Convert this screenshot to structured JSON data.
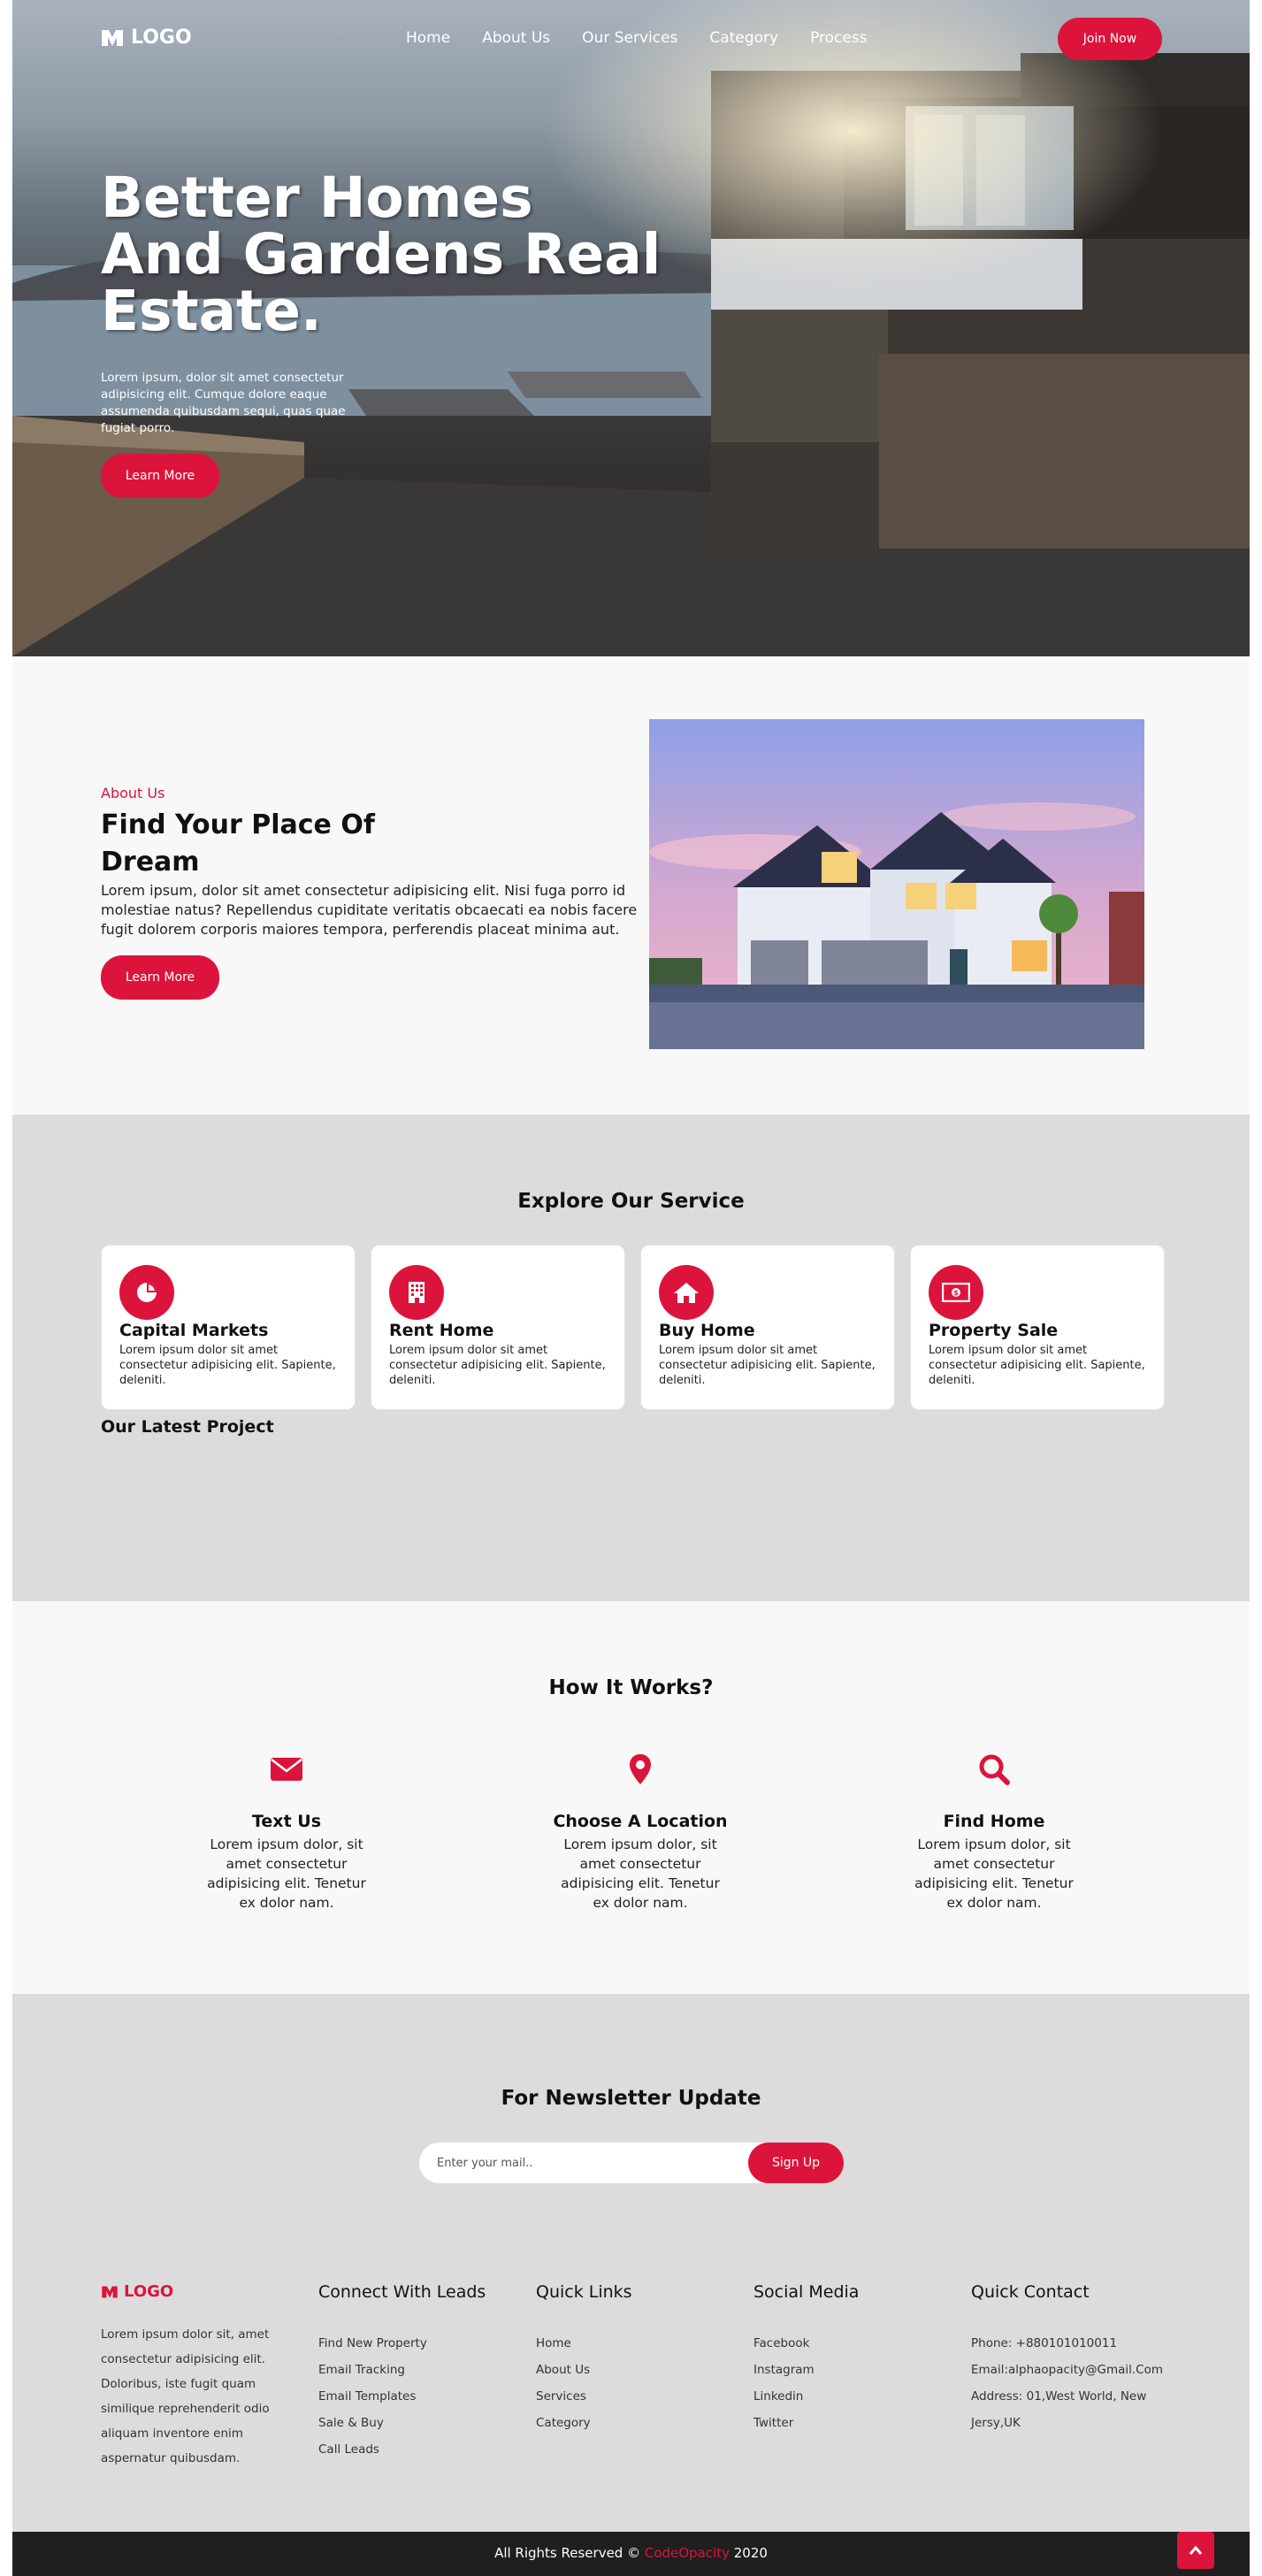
{
  "header": {
    "logo_text": "LOGO",
    "nav": [
      "Home",
      "About Us",
      "Our Services",
      "Category",
      "Process"
    ],
    "join_label": "Join Now"
  },
  "hero": {
    "title": "Better Homes And Gardens Real Estate.",
    "text": "Lorem ipsum, dolor sit amet consectetur adipisicing elit. Cumque dolore eaque assumenda quibusdam sequi, quas quae fugiat porro.",
    "button_label": "Learn More"
  },
  "about": {
    "eyebrow": "About Us",
    "title": "Find Your Place Of Dream",
    "text": "Lorem ipsum, dolor sit amet consectetur adipisicing elit. Nisi fuga porro id molestiae natus? Repellendus cupiditate veritatis obcaecati ea nobis facere fugit dolorem corporis maiores tempora, perferendis placeat minima aut.",
    "button_label": "Learn More"
  },
  "services": {
    "title": "Explore Our Service",
    "cards": [
      {
        "icon": "pie-chart-icon",
        "title": "Capital Markets",
        "text": "Lorem ipsum dolor sit amet consectetur adipisicing elit. Sapiente, deleniti."
      },
      {
        "icon": "building-icon",
        "title": "Rent Home",
        "text": "Lorem ipsum dolor sit amet consectetur adipisicing elit. Sapiente, deleniti."
      },
      {
        "icon": "home-icon",
        "title": "Buy Home",
        "text": "Lorem ipsum dolor sit amet consectetur adipisicing elit. Sapiente, deleniti."
      },
      {
        "icon": "money-bill-icon",
        "title": "Property Sale",
        "text": "Lorem ipsum dolor sit amet consectetur adipisicing elit. Sapiente, deleniti."
      }
    ],
    "latest_title": "Our Latest Project"
  },
  "how": {
    "title": "How It Works?",
    "steps": [
      {
        "icon": "envelope-icon",
        "title": "Text Us",
        "text": "Lorem ipsum dolor, sit amet consectetur adipisicing elit. Tenetur ex dolor nam."
      },
      {
        "icon": "map-marker-icon",
        "title": "Choose A Location",
        "text": "Lorem ipsum dolor, sit amet consectetur adipisicing elit. Tenetur ex dolor nam."
      },
      {
        "icon": "search-icon",
        "title": "Find Home",
        "text": "Lorem ipsum dolor, sit amet consectetur adipisicing elit. Tenetur ex dolor nam."
      }
    ]
  },
  "newsletter": {
    "title": "For Newsletter Update",
    "placeholder": "Enter your mail..",
    "button_label": "Sign Up"
  },
  "footer": {
    "logo_text": "LOGO",
    "about_text": "Lorem ipsum dolor sit, amet consectetur adipisicing elit. Doloribus, iste fugit quam similique reprehenderit odio aliquam inventore enim aspernatur quibusdam.",
    "columns": [
      {
        "title": "Connect With Leads",
        "items": [
          "Find New Property",
          "Email Tracking",
          "Email Templates",
          "Sale & Buy",
          "Call Leads"
        ]
      },
      {
        "title": "Quick Links",
        "items": [
          "Home",
          "About Us",
          "Services",
          "Category"
        ]
      },
      {
        "title": "Social Media",
        "items": [
          "Facebook",
          "Instagram",
          "Linkedin",
          "Twitter"
        ]
      },
      {
        "title": "Quick Contact",
        "items": [
          "Phone: +880101010011",
          "Email:alphaopacity@Gmail.Com",
          "Address: 01,West World, New Jersy,UK"
        ]
      }
    ],
    "copyright_prefix": "All Rights Reserved ©",
    "copyright_brand": "CodeOpacity",
    "copyright_year": "2020"
  },
  "colors": {
    "accent": "#dc143c",
    "section_gray": "#dcdcdc",
    "section_light": "#f8f8f8",
    "bottom_bar": "#1f1f1f"
  }
}
